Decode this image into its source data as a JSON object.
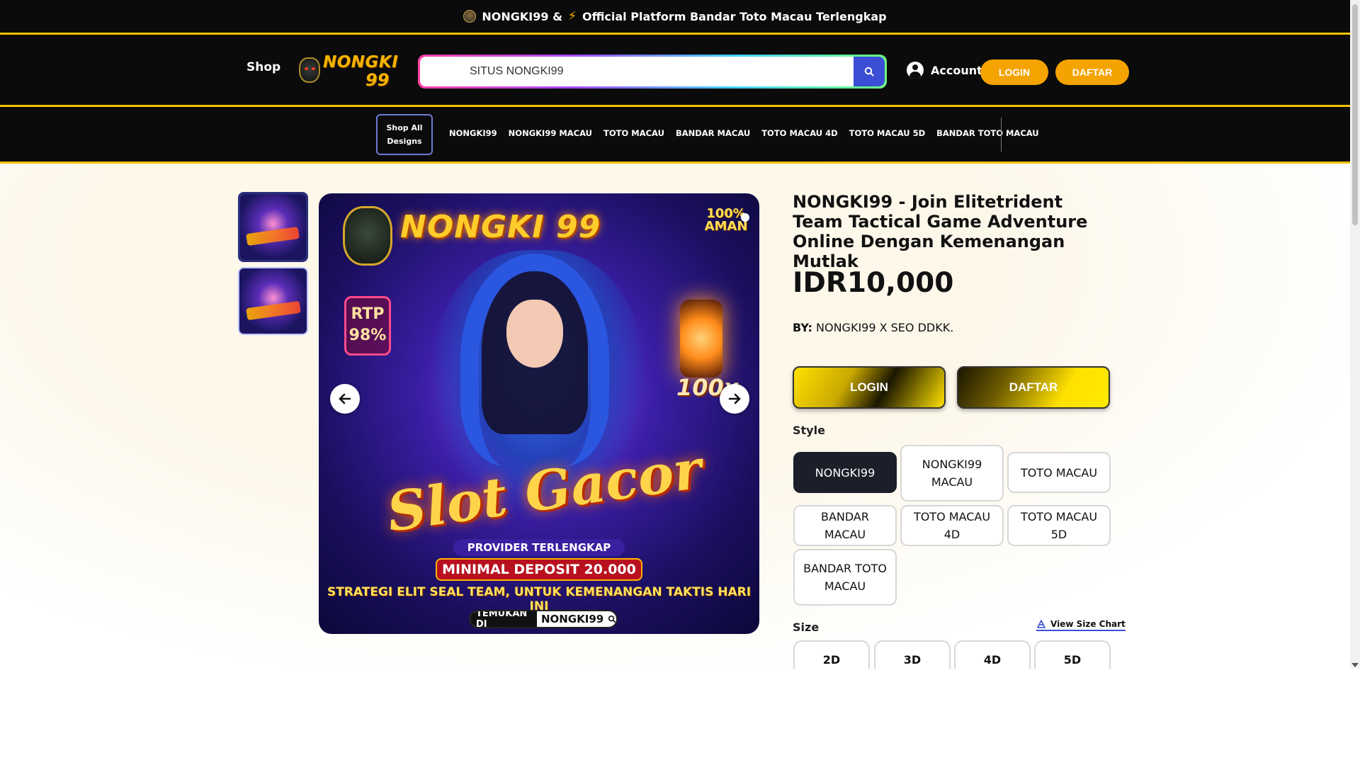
{
  "announcement": {
    "site_name": "NONGKI99 &",
    "tagline": "Official Platform Bandar Toto Macau Terlengkap"
  },
  "header": {
    "shop_label": "Shop",
    "logo_text": "NONGKI",
    "logo_number": "99",
    "search_value": "SITUS NONGKI99",
    "account_label": "Account",
    "login_label": "LOGIN",
    "daftar_label": "DAFTAR"
  },
  "nav": {
    "shop_all_label": "Shop All Designs",
    "links": [
      "NONGKI99",
      "NONGKI99 MACAU",
      "TOTO MACAU",
      "BANDAR MACAU",
      "TOTO MACAU 4D",
      "TOTO MACAU 5D",
      "BANDAR TOTO MACAU"
    ]
  },
  "banner": {
    "brand": "NONGKI 99",
    "aman": "100% AMAN",
    "rtp": "RTP 98%",
    "multiplier": "100x",
    "script_text": "Slot Gacor",
    "provider": "PROVIDER TERLENGKAP",
    "deposit": "MINIMAL DEPOSIT 20.000",
    "strategi": "STRATEGI ELIT SEAL TEAM, UNTUK KEMENANGAN TAKTIS HARI INI",
    "temukan": "TEMUKAN DI",
    "temukan_brand": "NONGKI99"
  },
  "product": {
    "title": "NONGKI99 - Join Elitetrident Team Tactical Game Adventure Online Dengan Kemenangan Mutlak",
    "price": "IDR10,000",
    "by_label": "BY:",
    "by_value": "NONGKI99 X SEO DDKK.",
    "login_label": "LOGIN",
    "daftar_label": "DAFTAR",
    "style_label": "Style",
    "styles": [
      "NONGKI99",
      "NONGKI99 MACAU",
      "TOTO MACAU",
      "BANDAR MACAU",
      "TOTO MACAU 4D",
      "TOTO MACAU 5D",
      "BANDAR TOTO MACAU"
    ],
    "selected_style": "NONGKI99",
    "size_label": "Size",
    "size_chart_label": "View Size Chart",
    "sizes": [
      "2D",
      "3D",
      "4D",
      "5D"
    ]
  },
  "colors": {
    "accent_gold": "#f2c200",
    "button_orange": "#f5a300",
    "search_button": "#3b4fd6",
    "dark": "#0b0b0b"
  }
}
